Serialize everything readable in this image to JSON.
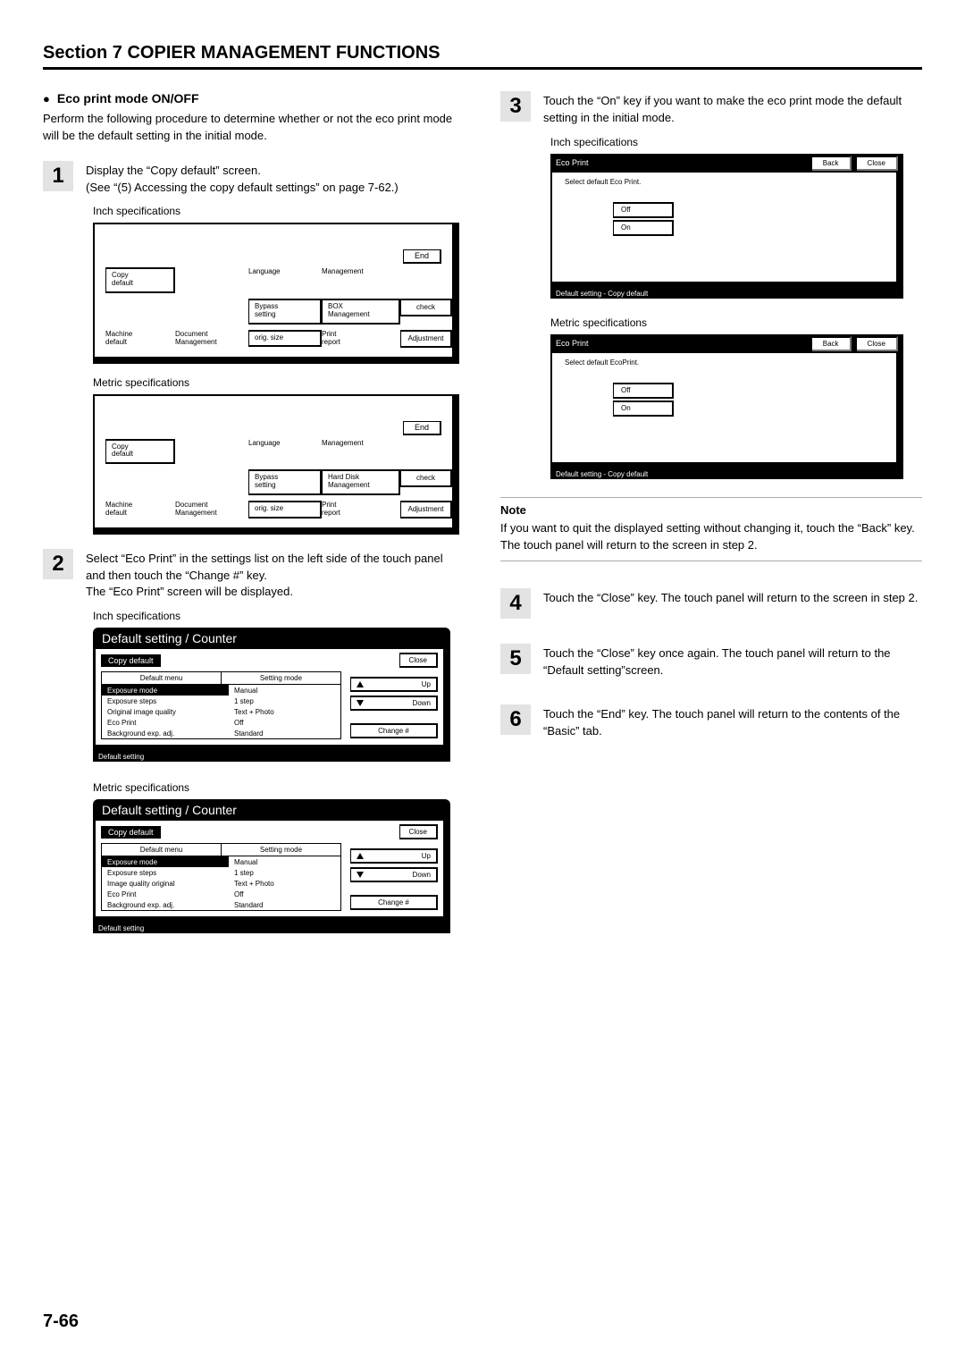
{
  "section_title": "Section 7  COPIER MANAGEMENT FUNCTIONS",
  "sub_heading": "Eco print mode ON/OFF",
  "intro": "Perform the following procedure to determine whether or not the eco print mode will be the default setting in the initial mode.",
  "steps": {
    "s1": "Display the “Copy default” screen.\n(See “(5) Accessing the copy default settings” on page 7-62.)",
    "s2": "Select “Eco Print” in the settings list on the left side of the touch panel and then touch the “Change #” key.\nThe “Eco Print” screen will be displayed.",
    "s3": "Touch the “On” key if you want to make the eco print mode the default setting in the initial mode.",
    "s4": "Touch the “Close” key. The touch panel will return to the screen in step 2.",
    "s5": "Touch the “Close” key once again. The touch panel will return to the “Default setting”screen.",
    "s6": "Touch the “End” key. The touch panel will return to the contents of the “Basic” tab."
  },
  "labels": {
    "inch": "Inch specifications",
    "metric": "Metric specifications",
    "note": "Note"
  },
  "menu": {
    "end": "End",
    "copy_default": "Copy\ndefault",
    "language": "Language",
    "management": "Management",
    "bypass": "Bypass\nsetting",
    "box": "BOX\nManagement",
    "harddisk": "Hard Disk\nManagement",
    "machine": "Machine\ndefault",
    "document": "Document\nManagement",
    "orig": "orig. size",
    "print": "Print\nreport",
    "check": "check",
    "adjust": "Adjustment"
  },
  "ds": {
    "title": "Default setting / Counter",
    "copy_default": "Copy default",
    "close": "Close",
    "col_menu": "Default menu",
    "col_mode": "Setting mode",
    "up": "Up",
    "down": "Down",
    "change": "Change #",
    "footer": "Default setting",
    "rows_inch": [
      {
        "a": "Exposure mode",
        "b": "Manual",
        "hl": true
      },
      {
        "a": "Exposure steps",
        "b": "1 step"
      },
      {
        "a": "Original image quality",
        "b": "Text + Photo"
      },
      {
        "a": "Eco Print",
        "b": "Off"
      },
      {
        "a": "Background exp. adj.",
        "b": "Standard"
      }
    ],
    "rows_metric": [
      {
        "a": "Exposure mode",
        "b": "Manual",
        "hl": true
      },
      {
        "a": "Exposure steps",
        "b": "1 step"
      },
      {
        "a": "Image quality original",
        "b": "Text + Photo"
      },
      {
        "a": "Eco Print",
        "b": "Off"
      },
      {
        "a": "Background exp. adj.",
        "b": "Standard"
      }
    ]
  },
  "eco": {
    "header": "Eco Print",
    "back": "Back",
    "close": "Close",
    "prompt_inch": "Select default Eco Print.",
    "prompt_metric": "Select default EcoPrint.",
    "off": "Off",
    "on": "On",
    "footer": "Default setting - Copy default"
  },
  "note_text": "If you want to quit the displayed setting without changing it, touch the “Back” key. The touch panel will return to the screen in step 2.",
  "page_num": "7-66"
}
